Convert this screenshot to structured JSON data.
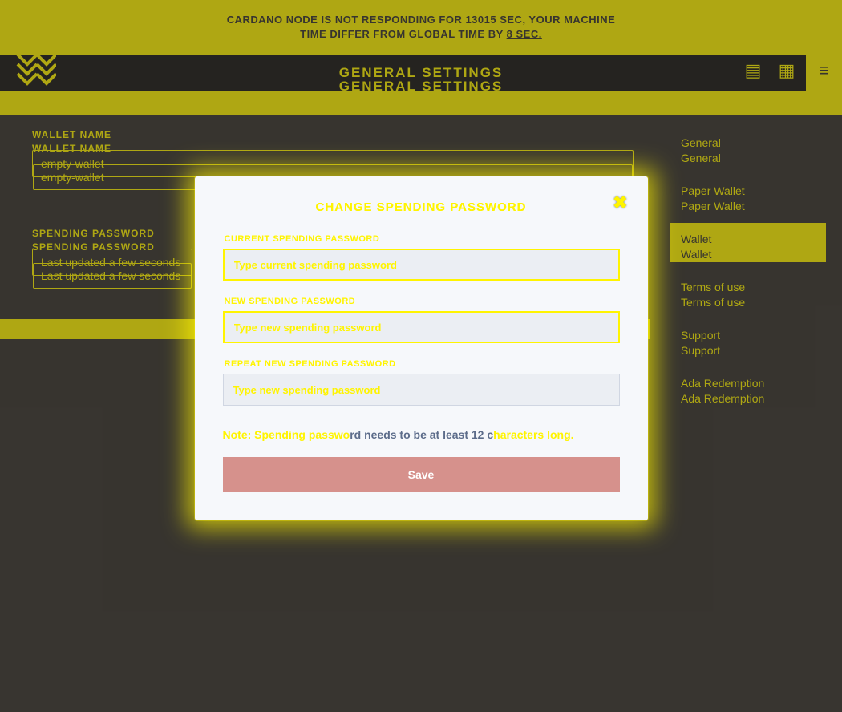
{
  "banner": {
    "line1": "CARDANO NODE IS NOT RESPONDING FOR 13015 SEC, YOUR MACHINE",
    "line2_pre": "TIME DIFFER FROM GLOBAL TIME BY ",
    "line2_underline": "8 SEC."
  },
  "header": {
    "title": "GENERAL SETTINGS"
  },
  "fields": {
    "wallet_name_label": "WALLET NAME",
    "wallet_name_value": "empty-wallet",
    "spending_password_label": "SPENDING PASSWORD",
    "spending_password_value": "Last updated a few seconds"
  },
  "nav": {
    "items": [
      {
        "label": "General",
        "active": false
      },
      {
        "label": "Paper Wallet",
        "active": false
      },
      {
        "label": "Wallet",
        "active": true
      },
      {
        "label": "Terms of use",
        "active": false
      },
      {
        "label": "Support",
        "active": false
      },
      {
        "label": "Ada Redemption",
        "active": false
      }
    ]
  },
  "modal": {
    "title_pre": "CH",
    "title_y1": "ANG",
    "title_mid": "E SPEND",
    "title_y2": "I",
    "title_mid2": "NG PASS",
    "title_y3": "W",
    "title_post": "ORD",
    "current_label_pre": "CU",
    "current_label_y": "RRENT SPENDING PASSWORD",
    "current_placeholder": "Type current spending password",
    "new_label_y": "NEW SPE",
    "new_label_mid": "NDING P",
    "new_label_y2": "ASSWORD",
    "new_placeholder": "Type new spending password",
    "repeat_label_pre": "REPE",
    "repeat_label_y": "AT NEW SPE",
    "repeat_label_mid": "NDIN",
    "repeat_label_y2": "G PASSWORD",
    "repeat_placeholder": "Type new spending password",
    "note_pre": "Note: Spending passwo",
    "note_mid": "rd needs to be at least 12 c",
    "note_post": "haracters long.",
    "save_label": "Save",
    "close_label": "✖"
  }
}
